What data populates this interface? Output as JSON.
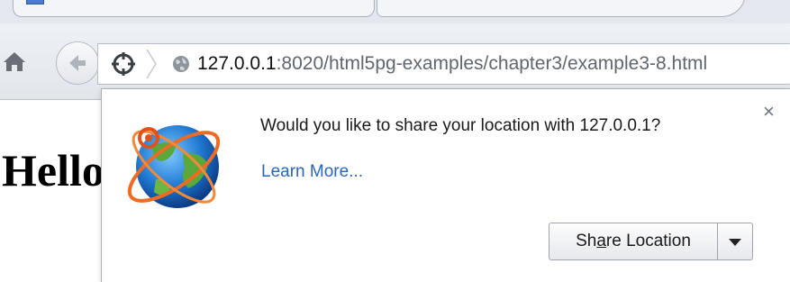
{
  "tabs": [
    {
      "title": ""
    },
    {
      "title": ""
    }
  ],
  "toolbar": {
    "url_host": "127.0.0.1",
    "url_rest": ":8020/html5pg-examples/chapter3/example3-8.html"
  },
  "page": {
    "heading": "Hello"
  },
  "popup": {
    "message": "Would you like to share your location with 127.0.0.1?",
    "learn_more": "Learn More...",
    "close_symbol": "×",
    "share_prefix": "Sh",
    "share_mnemonic": "a",
    "share_suffix": "re Location"
  },
  "icons": {
    "home": "home-icon",
    "back": "back-arrow-icon",
    "geolocation": "geolocation-crosshair-icon",
    "globe": "globe-icon",
    "logo": "earth-orbit-logo-icon",
    "dropdown": "dropdown-arrow-icon"
  },
  "colors": {
    "link": "#2a66b8",
    "url_host": "#111111",
    "url_rest": "#5f6670"
  }
}
